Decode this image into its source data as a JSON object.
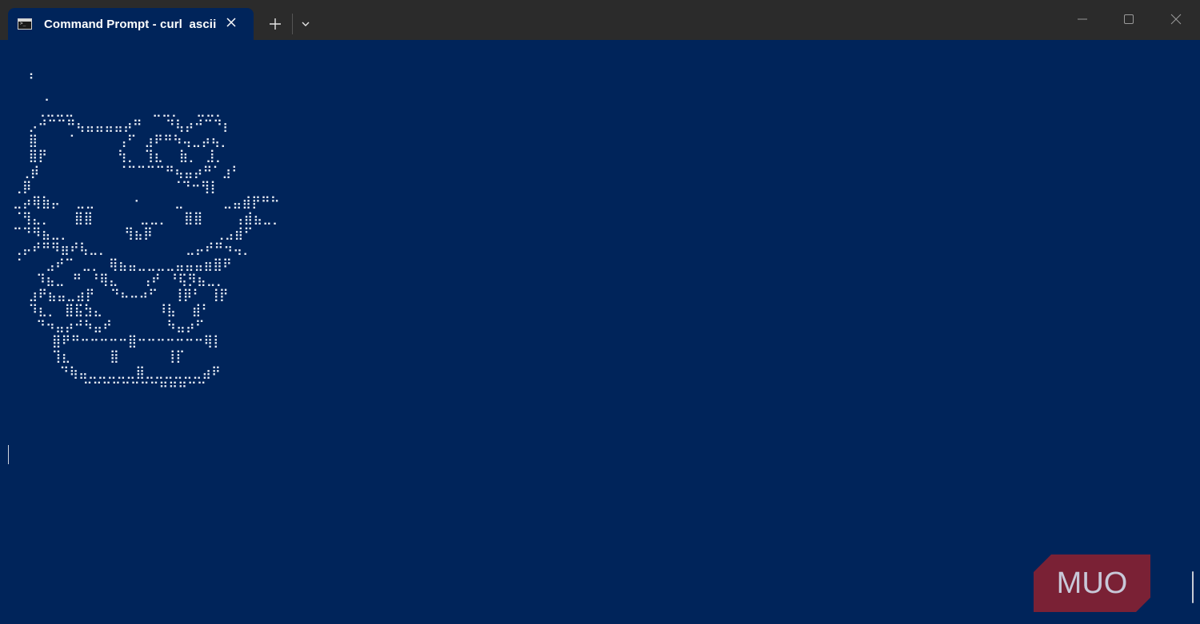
{
  "window": {
    "tab_title": "Command Prompt - curl  ascii",
    "tab_icon": "command-prompt-icon",
    "new_tab_icon": "plus-icon",
    "dropdown_icon": "chevron-down-icon",
    "close_tab_icon": "close-icon",
    "controls": {
      "minimize_icon": "minimize-icon",
      "maximize_icon": "maximize-icon",
      "close_icon": "close-icon"
    }
  },
  "terminal": {
    "background_color": "#00245a",
    "text_color": "#e6ecf5",
    "ascii_art": "  ⠃\n    ⡀\n   ⢀⣀⣀⣀          ⣀⣀⡀  ⣀⣀⡀\n  ⡠⠚⠉⠉⠛⢦⣤⣤⣤⣤⡴⠛   ⠙⢧⡴⠚⠉⠙⡆\n  ⣿    ⠁     ⢠⠋ ⣰⠟⠛⠳⢤⣀⡴⢦⡀\n  ⣿⡟         ⢳⡀ ⢹⣆  ⣷⡀ ⣸⡀\n ⢀⡾          ⠈⠉⠉⠉⠉⠛⢦⣤⡴⠛⠁⣰⠃\n⢀⡿                  ⠈⠙⠒⢻⡇\n⣀⡴⢿⣷⡤  ⣀⣀     ⠂    ⣀     ⣀⣤⣾⡟⠛⠓\n⠈⢻⣄⡀   ⣿⣿      ⣀⣀⡀  ⣿⣿    ⢠⣾⣦⣀⡀\n⠉⠙⠻⣦⣀⡀       ⢻⣦⡿        ⢀⣠⣾⠋\n⢀⡤⠞⠛⠻⣶⠞⢧⣀⡀          ⣀⡤⠞⠛⠲⢤⡀\n⠈   ⣠⠞⠉ ⣀⡀ ⢿⣦⣤⣀⣀⣀⣀⣤⣤⣤⣶⣿⠟\n   ⠹⣦⣀ ⠛ ⠘⢿⣄   ⢠⠞ ⠘⢯⡻⣦⣀⡀\n  ⣰⠟⣦⣤⣀⣴⡟  ⠙⠦⠤⠴⠋  ⢸⡿⠃ ⢸⡟\n  ⠹⣆⡀ ⣿⣯⣳⣄       ⠸⣧  ⣾⠃\n   ⠙⠲⣤⡴⠚⠳⣤⠞       ⠳⣤⡴⠋\n     ⣿⠟⠛⠒⠒⠒⠒⠒⣿⠒⠒⠒⠒⠒⠒⠒⢿⡇\n     ⢹⣆     ⣿      ⢸⡏\n      ⠙⢷⣤⣀⣀⣀⣀⣀⣿⣀⣀⣀⣀⣀⣀⣴⠟\n         ⠉⠉⠉⠉⠉⠉⠉⠉⠛⠛⠛⠉⠉"
  },
  "watermark": {
    "text": "MUO",
    "bg_color": "#7a2135",
    "text_color": "#c8c8d8"
  }
}
